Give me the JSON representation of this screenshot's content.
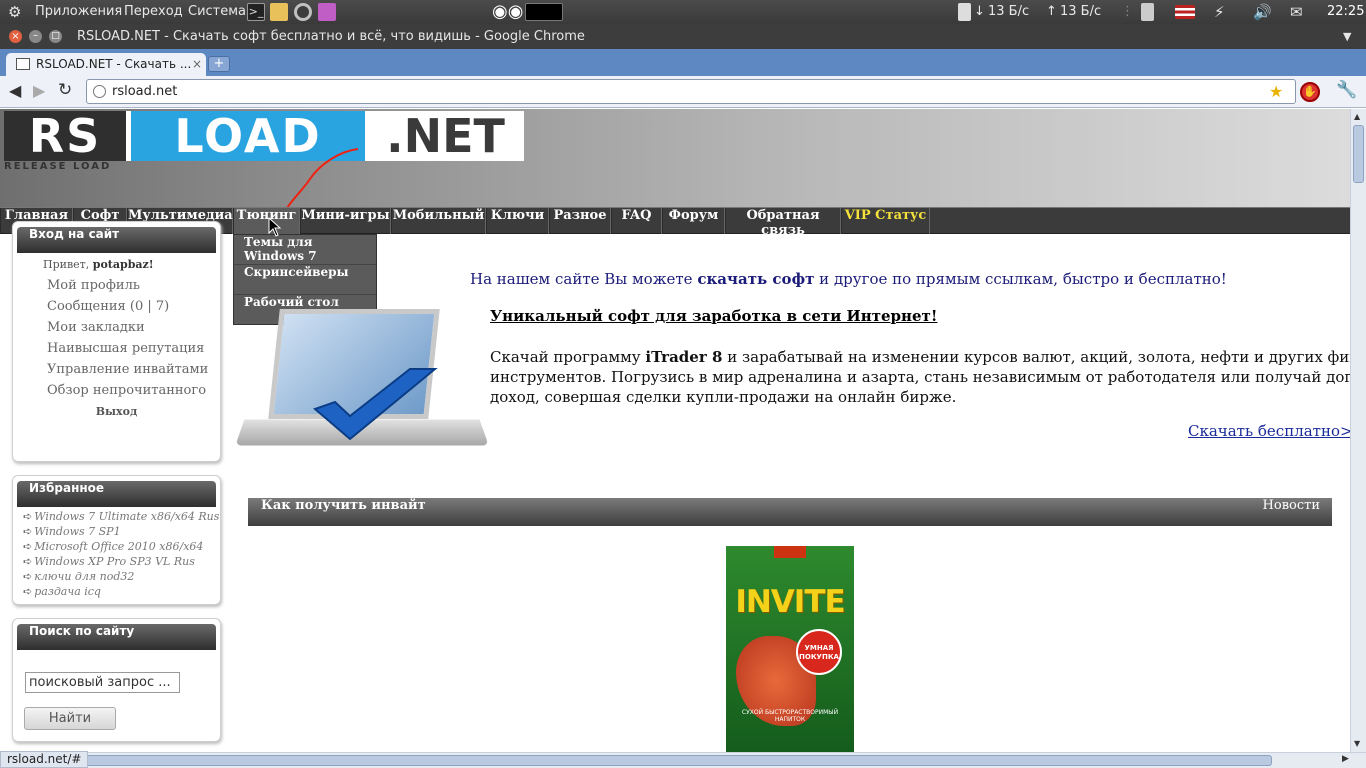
{
  "panel": {
    "apps": "Приложения",
    "places": "Переход",
    "system": "Система",
    "net_down": "13 Б/с",
    "net_up": "13 Б/с",
    "clock": "22:25"
  },
  "window": {
    "title": "RSLOAD.NET - Скачать софт бесплатно и всё, что видишь - Google Chrome"
  },
  "tabs": [
    {
      "label": "RSLOAD.NET - Скачать ..."
    }
  ],
  "toolbar": {
    "url": "rsload.net"
  },
  "site": {
    "logo_rs": "RS",
    "logo_load": "LOAD",
    "logo_net": ".NET",
    "logo_sub": "RELEASE LOAD",
    "menu": [
      "Главная",
      "Софт",
      "Мультимедиа",
      "Тюнинг",
      "Мини-игры",
      "Мобильный",
      "Ключи",
      "Разное",
      "FAQ",
      "Форум",
      "Обратная связь",
      "VIP Статус"
    ],
    "dropdown": [
      "Темы для Windows 7",
      "Скринсейверы",
      "Рабочий стол"
    ],
    "login": {
      "title": "Вход на сайт",
      "greeting": "Привет,",
      "user": "potapbaz!",
      "links": [
        "Мой профиль",
        "Сообщения (0 | 7)",
        "Мои закладки",
        "Наивысшая репутация",
        "Управление инвайтами",
        "Обзор непрочитанного"
      ],
      "logout": "Выход"
    },
    "favorites": {
      "title": "Избранное",
      "items": [
        "Windows 7 Ultimate x86/x64 Rus",
        "Windows 7 SP1",
        "Microsoft Office 2010 x86/x64",
        "Windows XP Pro SP3 VL Rus",
        "ключи для nod32",
        "раздача icq"
      ]
    },
    "search": {
      "title": "Поиск по сайту",
      "value": "поисковый запрос ...",
      "button": "Найти"
    },
    "intro": {
      "pre": "На нашем сайте Вы можете",
      "bold": "скачать софт",
      "post": "и другое по прямым ссылкам, быстро и бесплатно!"
    },
    "promo": {
      "heading": "Уникальный софт для заработка в сети Интернет!",
      "p1": "Скачай программу",
      "p_bold": "iTrader 8",
      "p2": "и зарабатывай на изменении курсов валют, акций, золота, нефти и других финансовых",
      "p3": "инструментов. Погрузись в мир адреналина и азарта, стань независимым от работодателя или получай дополнительный",
      "p4": "доход, совершая сделки купли-продажи на онлайн бирже.",
      "download": "Скачать бесплатно>>>"
    },
    "news": {
      "title": "Как получить инвайт",
      "tag": "Новости"
    },
    "pack": {
      "brand": "INVITE",
      "badge1": "УМНАЯ",
      "badge2": "ПОКУПКА",
      "caption": "СУХОЙ БЫСТРОРАСТВОРИМЫЙ НАПИТОК"
    }
  },
  "status": {
    "url": "rsload.net/#"
  }
}
